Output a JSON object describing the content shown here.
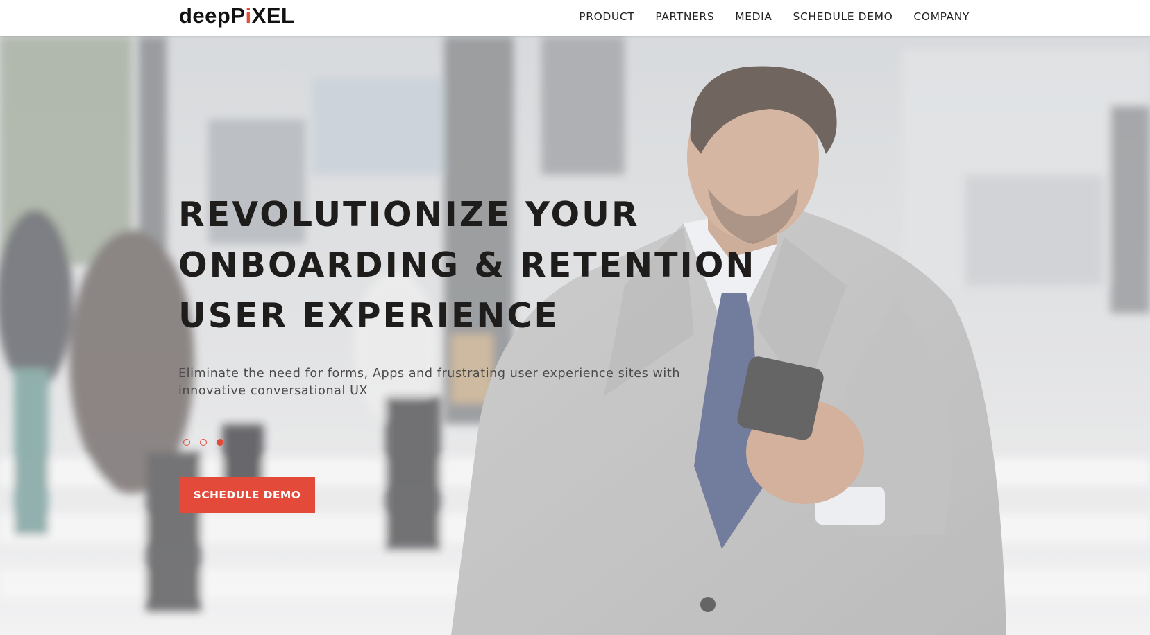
{
  "brand": {
    "logo_prefix": "deepP",
    "logo_i": "i",
    "logo_suffix": "XEL",
    "accent_color": "#e34a3a"
  },
  "nav": {
    "items": [
      {
        "label": "PRODUCT"
      },
      {
        "label": "PARTNERS"
      },
      {
        "label": "MEDIA"
      },
      {
        "label": "SCHEDULE DEMO"
      },
      {
        "label": "COMPANY"
      }
    ]
  },
  "hero": {
    "headline": "REVOLUTIONIZE YOUR ONBOARDING & RETENTION USER EXPERIENCE",
    "subtitle": "Eliminate the need for forms, Apps and frustrating user experience sites with innovative conversational UX",
    "carousel": {
      "slide_count": 3,
      "active_slide": 3
    },
    "cta_label": "SCHEDULE DEMO",
    "background_image": "businessman-with-smartphone-on-city-street"
  }
}
